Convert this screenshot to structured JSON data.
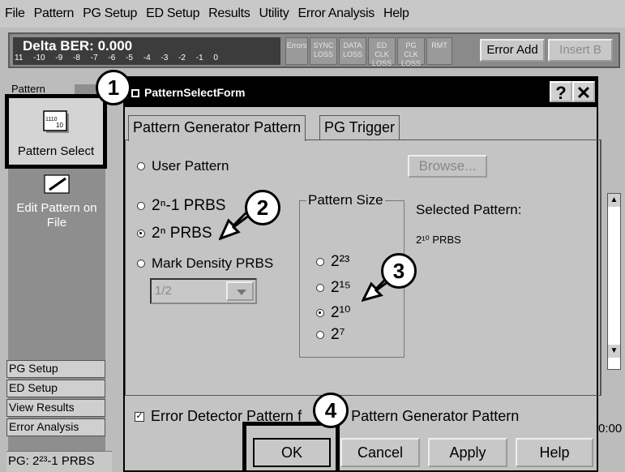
{
  "menubar": {
    "items": [
      "File",
      "Pattern",
      "PG Setup",
      "ED Setup",
      "Results",
      "Utility",
      "Error Analysis",
      "Help"
    ]
  },
  "toolbar": {
    "ber_title": "Delta BER: 0.000",
    "ber_scale": "11 -10 -9 -8 -7 -6 -5 -4 -3 -2 -1 0",
    "indicators": [
      "Errors",
      "SYNC LOSS",
      "DATA LOSS",
      "ED CLK LOSS",
      "PG CLK LOSS",
      "RMT"
    ],
    "error_add": "Error Add",
    "insert_b": "Insert B"
  },
  "left": {
    "pattern_tab": "Pattern",
    "pattern_select": "Pattern Select",
    "pattern_icon_text": "1110 10",
    "edit_pattern": "Edit Pattern on File",
    "nav": [
      "PG Setup",
      "ED Setup",
      "View Results",
      "Error Analysis"
    ],
    "status": "PG: 2²³-1 PRBS"
  },
  "right": {
    "time": "0:00"
  },
  "dialog": {
    "title": "PatternSelectForm",
    "help_btn": "?",
    "close_btn": "✕",
    "tabs": [
      "Pattern Generator Pattern",
      "PG Trigger"
    ],
    "user_pattern": "User Pattern",
    "browse": "Browse...",
    "prbs_2n1": "2ⁿ-1 PRBS",
    "prbs_2n": "2ⁿ PRBS",
    "mark_density": "Mark Density PRBS",
    "mark_density_value": "1/2",
    "pattern_size_title": "Pattern Size",
    "sizes": [
      "2²³",
      "2¹⁵",
      "2¹⁰",
      "2⁷"
    ],
    "selected_size_index": 2,
    "selected_pattern_title": "Selected Pattern:",
    "selected_pattern_value": "2¹⁰ PRBS",
    "checkbox_label": "Error Detector Pattern f",
    "checkbox_label_tail": "he Pattern Generator Pattern",
    "buttons": {
      "ok": "OK",
      "cancel": "Cancel",
      "apply": "Apply",
      "help": "Help"
    }
  },
  "callouts": [
    "1",
    "2",
    "3",
    "4"
  ]
}
